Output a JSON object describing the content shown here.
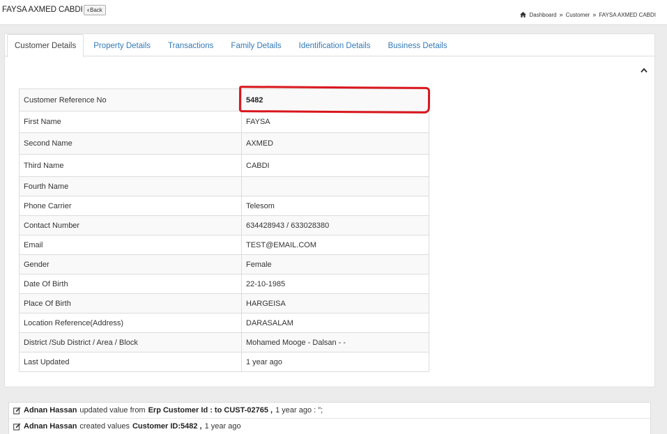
{
  "header": {
    "title": "FAYSA AXMED CABDI",
    "back_label": "Back",
    "breadcrumb": [
      "Dashboard",
      "Customer",
      "FAYSA AXMED CABDI"
    ],
    "breadcrumb_sep": "»"
  },
  "tabs": [
    {
      "label": "Customer Details",
      "active": true
    },
    {
      "label": "Property Details",
      "active": false
    },
    {
      "label": "Transactions",
      "active": false
    },
    {
      "label": "Family Details",
      "active": false
    },
    {
      "label": "Identification Details",
      "active": false
    },
    {
      "label": "Business Details",
      "active": false
    }
  ],
  "details": [
    {
      "label": "Customer Reference No",
      "value": "5482"
    },
    {
      "label": "First Name",
      "value": "FAYSA"
    },
    {
      "label": "Second Name",
      "value": "AXMED"
    },
    {
      "label": "Third Name",
      "value": "CABDI"
    },
    {
      "label": "Fourth Name",
      "value": ""
    },
    {
      "label": "Phone Carrier",
      "value": "Telesom"
    },
    {
      "label": "Contact Number",
      "value": "634428943 / 633028380"
    },
    {
      "label": "Email",
      "value": "TEST@EMAIL.COM"
    },
    {
      "label": "Gender",
      "value": "Female"
    },
    {
      "label": "Date Of Birth",
      "value": "22-10-1985"
    },
    {
      "label": "Place Of Birth",
      "value": "HARGEISA"
    },
    {
      "label": "Location Reference(Address)",
      "value": "DARASALAM"
    },
    {
      "label": "District /Sub District / Area / Block",
      "value": "Mohamed Mooge - Dalsan - -"
    },
    {
      "label": "Last Updated",
      "value": "1 year ago"
    }
  ],
  "activity": [
    {
      "user": "Adnan Hassan",
      "action": "updated value from",
      "field": "Erp Customer Id : to CUST-02765 ,",
      "time": "1 year ago : \";"
    },
    {
      "user": "Adnan Hassan",
      "action": "created values",
      "field": "Customer ID:5482 ,",
      "time": "1 year ago"
    }
  ],
  "colors": {
    "link": "#337ab7",
    "highlight": "#d9161c"
  },
  "icons": {
    "home": "home-icon",
    "collapse": "chevron-up-icon",
    "edit": "edit-icon"
  }
}
